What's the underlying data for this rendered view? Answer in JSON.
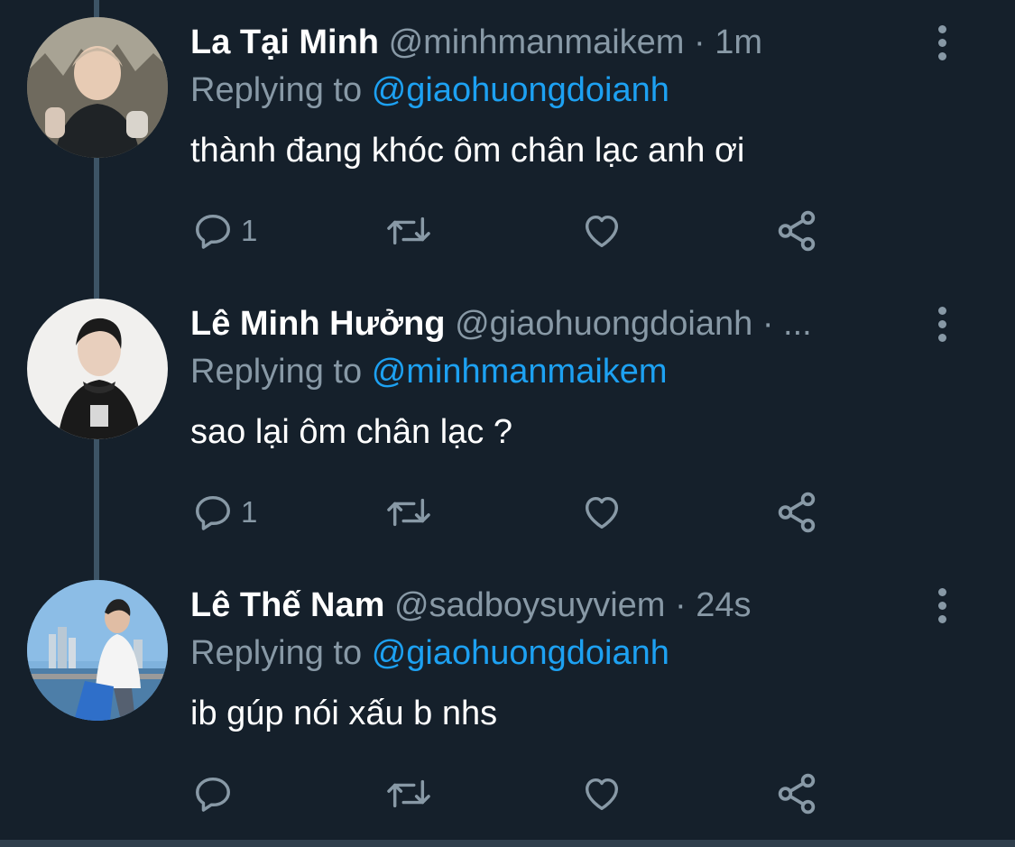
{
  "theme": {
    "background": "#15202b",
    "text_primary": "#ffffff",
    "text_secondary": "#8899a6",
    "link_color": "#1da1f2",
    "thread_line": "#3d5466"
  },
  "tweets": [
    {
      "display_name": "La Tại Minh",
      "handle": "@minhmanmaikem",
      "separator": "·",
      "time": "1m",
      "replying_prefix": "Replying to",
      "replying_to": "@giaohuongdoianh",
      "text": "thành đang khóc ôm chân lạc anh ơi",
      "reply_count": "1",
      "avatar": "user-avatar-photo"
    },
    {
      "display_name": "Lê Minh Hưởng",
      "handle": "@giaohuongdoianh",
      "separator": "·",
      "time": "...",
      "replying_prefix": "Replying to",
      "replying_to": "@minhmanmaikem",
      "text": "sao lại ôm chân lạc ?",
      "reply_count": "1",
      "avatar": "user-avatar-photo"
    },
    {
      "display_name": "Lê Thế Nam",
      "handle": "@sadboysuyviem",
      "separator": "·",
      "time": "24s",
      "replying_prefix": "Replying to",
      "replying_to": "@giaohuongdoianh",
      "text": "ib gúp nói xấu b nhs",
      "reply_count": "",
      "avatar": "user-avatar-photo"
    }
  ],
  "icons": {
    "reply": "reply-icon",
    "retweet": "retweet-icon",
    "like": "heart-icon",
    "share": "share-icon",
    "more": "more-vertical-icon"
  }
}
